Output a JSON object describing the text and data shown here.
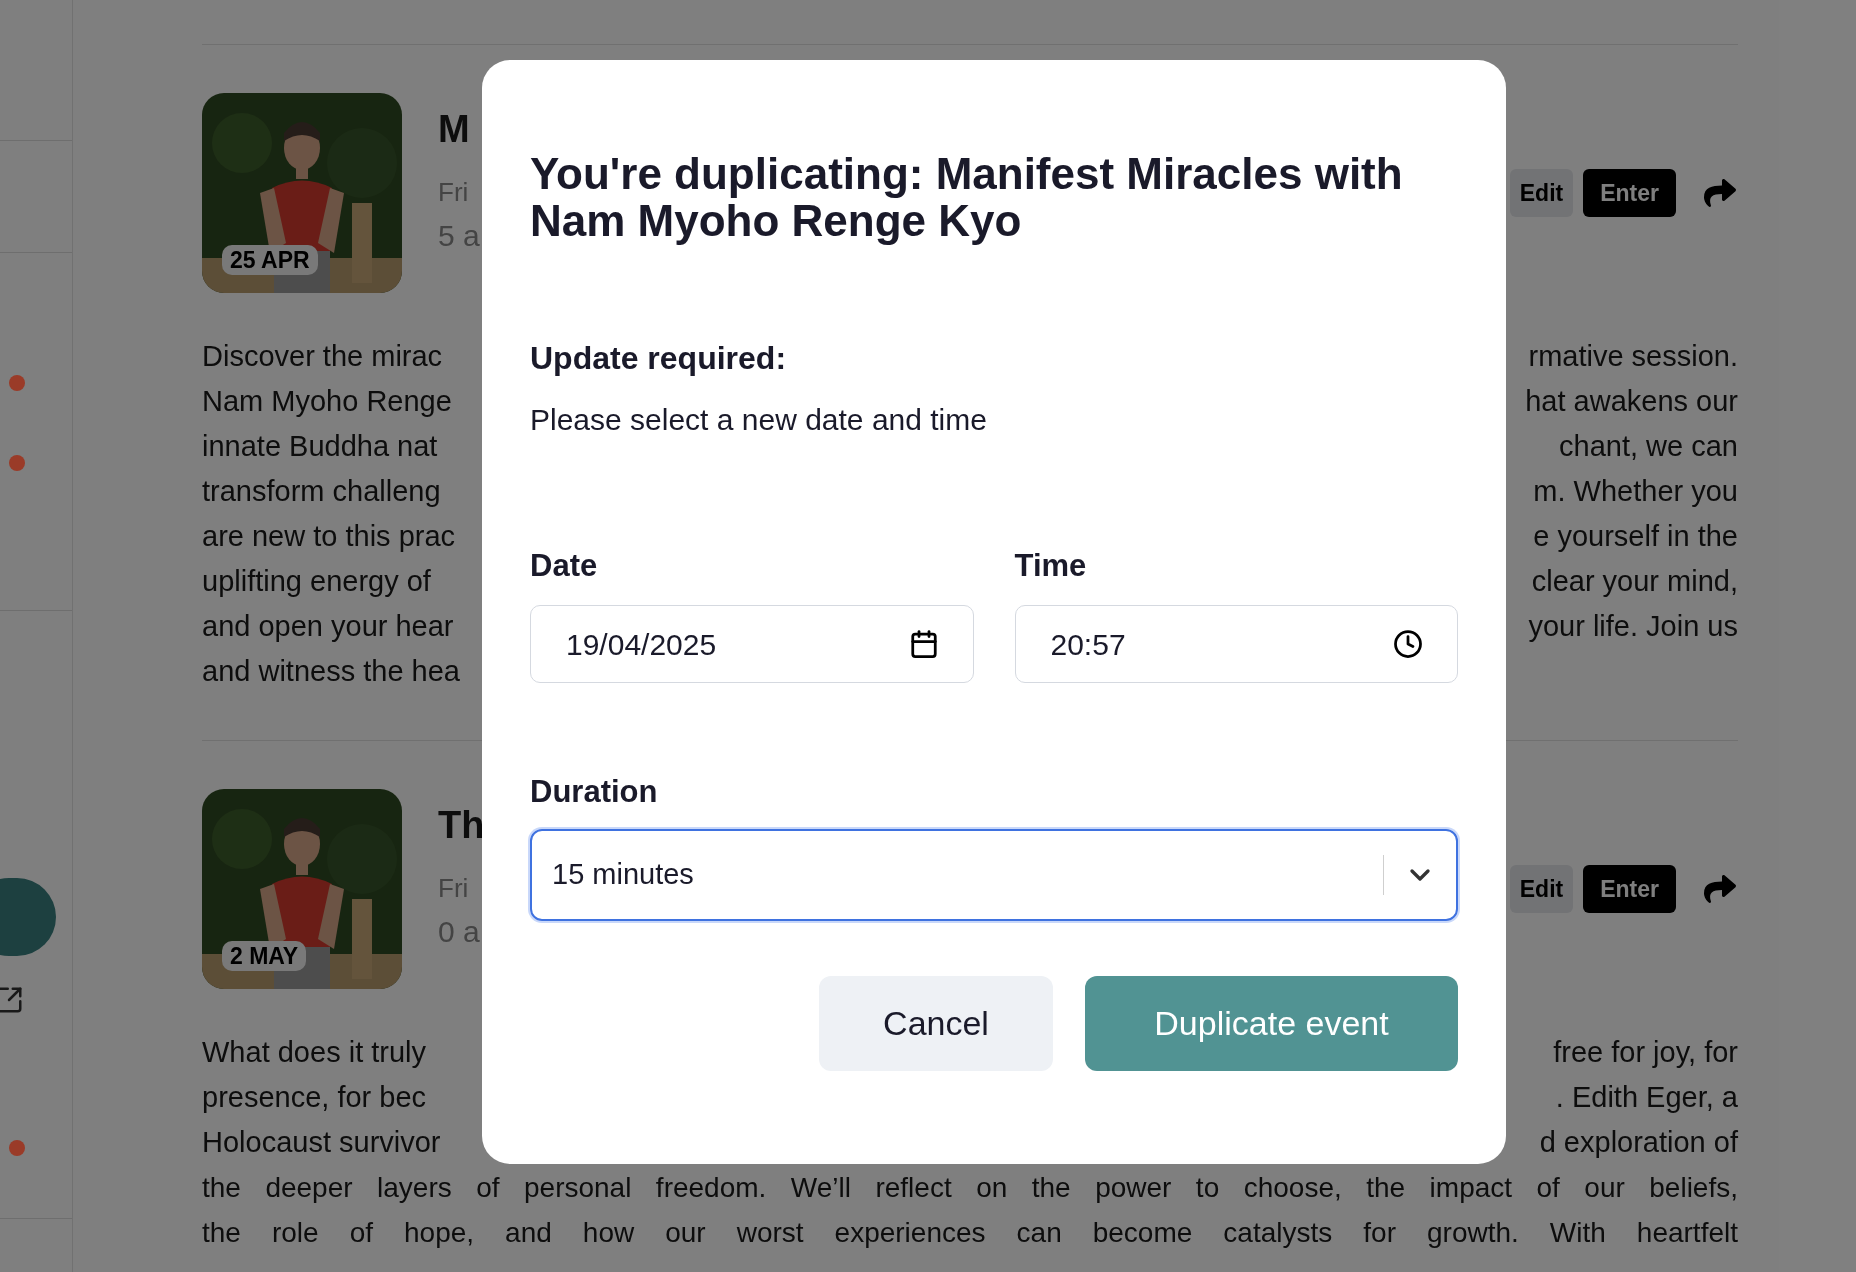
{
  "sidebar": {
    "status_dots": [
      {
        "color": "#9a3b28"
      },
      {
        "color": "#9a3b28"
      },
      {
        "color": "#9a3b28"
      }
    ]
  },
  "events": [
    {
      "badge": "25 APR",
      "title": "M",
      "meta": [
        "Fri",
        "5 a"
      ],
      "edit": "Edit",
      "enter": "Enter",
      "split_lines": [
        {
          "left": "Discover the mirac",
          "right": "rmative session."
        },
        {
          "left": "Nam Myoho Renge",
          "right": "hat awakens our"
        },
        {
          "left": "innate Buddha nat",
          "right": "chant, we can"
        },
        {
          "left": "transform challeng",
          "right": "m. Whether you"
        },
        {
          "left": "are new to this prac",
          "right": "e yourself in the"
        },
        {
          "left": "uplifting energy of",
          "right": "clear your mind,"
        },
        {
          "left": "and open your hear",
          "right": "your life. Join us"
        },
        {
          "left": "and witness the hea"
        }
      ]
    },
    {
      "badge": "2 MAY",
      "title": "Th",
      "meta": [
        "Fri",
        "0 a"
      ],
      "edit": "Edit",
      "enter": "Enter",
      "split_lines": [
        {
          "left": "What does it truly",
          "right": "free for joy, for"
        },
        {
          "left": "presence, for bec",
          "right": ". Edith Eger, a"
        },
        {
          "left": "Holocaust survivor",
          "right": "d exploration of"
        }
      ],
      "full_lines": [
        "the deeper layers of personal freedom. We’ll reflect on the power to choose, the impact of our beliefs,",
        "the role of hope, and how our worst experiences can become catalysts for growth. With heartfelt"
      ]
    }
  ],
  "dialog": {
    "title": "You're duplicating: Manifest Miracles with Nam Myoho Renge Kyo",
    "notice": {
      "heading": "Update required:",
      "text": "Please select a new date and time"
    },
    "date": {
      "label": "Date",
      "value": "19/04/2025"
    },
    "time": {
      "label": "Time",
      "value": "20:57"
    },
    "duration": {
      "label": "Duration",
      "value": "15 minutes",
      "focused": true
    },
    "buttons": [
      {
        "kind": "secondary",
        "label": "Cancel"
      },
      {
        "kind": "primary",
        "label": "Duplicate event"
      }
    ]
  }
}
